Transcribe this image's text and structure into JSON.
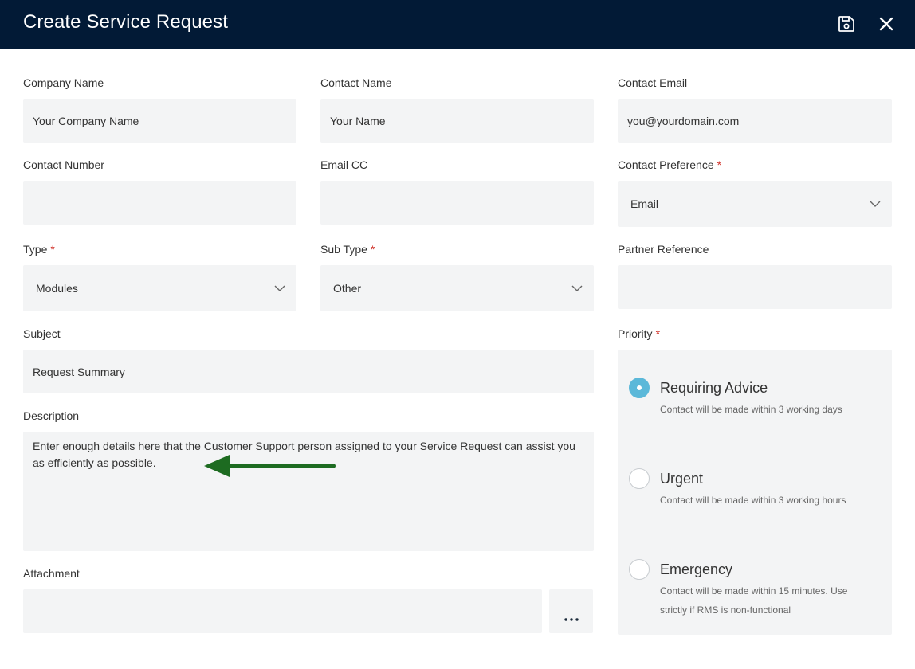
{
  "header": {
    "title": "Create Service Request"
  },
  "fields": {
    "company_name": {
      "label": "Company Name",
      "value": "Your Company Name"
    },
    "contact_name": {
      "label": "Contact Name",
      "value": "Your Name"
    },
    "contact_email": {
      "label": "Contact Email",
      "value": "you@yourdomain.com"
    },
    "contact_number": {
      "label": "Contact Number",
      "value": ""
    },
    "email_cc": {
      "label": "Email CC",
      "value": ""
    },
    "contact_preference": {
      "label": "Contact Preference",
      "value": "Email"
    },
    "type": {
      "label": "Type",
      "value": "Modules"
    },
    "sub_type": {
      "label": "Sub Type",
      "value": "Other"
    },
    "partner_reference": {
      "label": "Partner Reference",
      "value": ""
    },
    "subject": {
      "label": "Subject",
      "value": "Request Summary"
    },
    "description": {
      "label": "Description",
      "value": "Enter enough details here that the Customer Support person assigned to your Service Request can assist you as efficiently as possible."
    },
    "attachment": {
      "label": "Attachment",
      "value": "",
      "button_label": "..."
    }
  },
  "required_marker": "*",
  "priority": {
    "label": "Priority",
    "selected": "Requiring Advice",
    "options": [
      {
        "title": "Requiring Advice",
        "desc": "Contact will be made within 3 working days"
      },
      {
        "title": "Urgent",
        "desc": "Contact will be made within 3 working hours"
      },
      {
        "title": "Emergency",
        "desc": "Contact will be made within 15 minutes. Use strictly if RMS is non-functional"
      }
    ]
  },
  "colors": {
    "header_bg": "#021a36",
    "field_bg": "#f3f4f5",
    "required": "#d0342c",
    "radio_checked": "#5bb8d9",
    "arrow": "#1d6b21"
  },
  "icons": {
    "save": "save-icon",
    "close": "close-icon",
    "chevron": "chevron-down-icon",
    "annotation": "arrow-left-icon"
  }
}
